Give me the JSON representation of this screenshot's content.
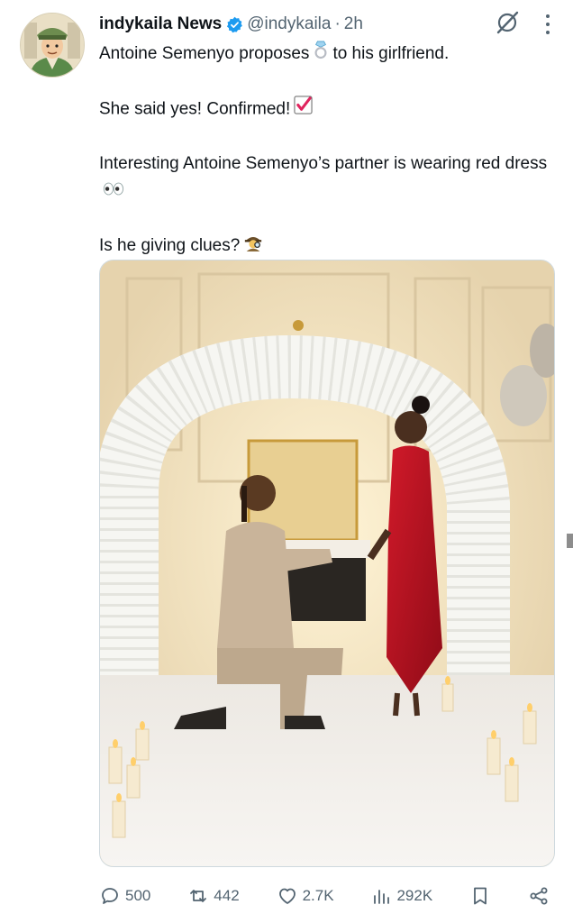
{
  "post": {
    "author_name": "indykaila News",
    "handle": "@indykaila",
    "separator": "·",
    "time": "2h",
    "text": {
      "line1_before": "Antoine Semenyo proposes",
      "line1_after": "to his girlfriend.",
      "line2": "She said yes! Confirmed!",
      "line3": "Interesting Antoine Semenyo’s partner is wearing red dress",
      "line4": "Is he giving clues?"
    },
    "icons": {
      "ring": "ring-emoji",
      "check": "check-mark-emoji",
      "eyes": "eyes-emoji",
      "detective": "detective-emoji"
    }
  },
  "actions": {
    "replies": "500",
    "reposts": "442",
    "likes": "2.7K",
    "views": "292K"
  },
  "colors": {
    "text": "#0f1419",
    "secondary": "#536471",
    "verified": "#1d9bf0",
    "check_red": "#e0245e"
  }
}
